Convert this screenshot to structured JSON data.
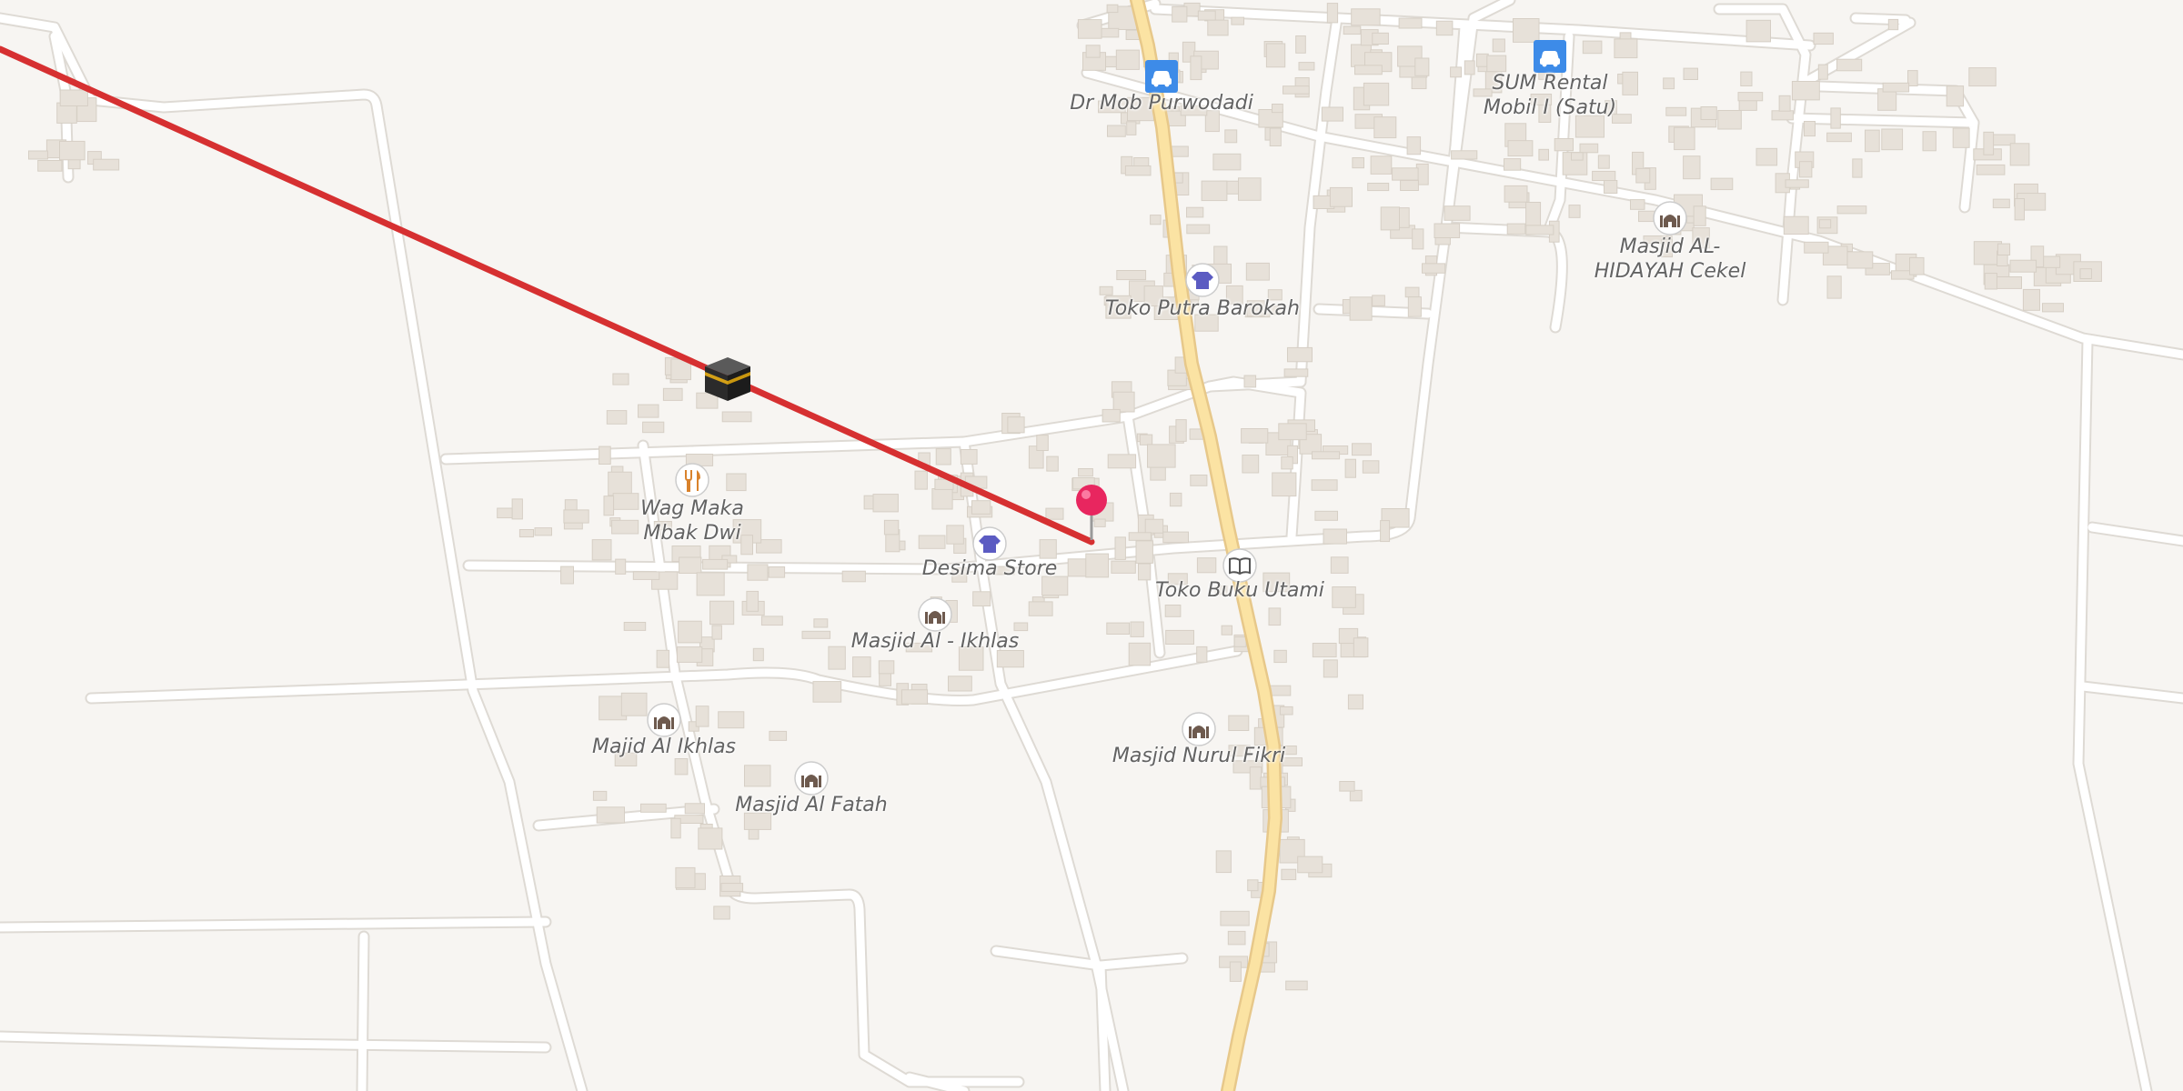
{
  "map": {
    "qibla_line_color": "#d63031",
    "pin_color": "#e8265f",
    "main_road_color": "#fbe3a3",
    "minor_road_color": "#ffffff",
    "background_color": "#f7f5f2",
    "pin_icon": "location-pin-icon",
    "qibla_icon": "kaaba-icon"
  },
  "pois": [
    {
      "id": "dr-mob-purwodadi",
      "label": "Dr Mob Purwodadi",
      "icon": "car-icon"
    },
    {
      "id": "sum-rental",
      "label": "SUM Rental\nMobil I (Satu)",
      "icon": "car-icon"
    },
    {
      "id": "masjid-al-hidayah",
      "label": "Masjid AL-\nHIDAYAH Cekel",
      "icon": "mosque-icon"
    },
    {
      "id": "toko-putra-barokah",
      "label": "Toko Putra Barokah",
      "icon": "clothes-icon"
    },
    {
      "id": "wag-maka",
      "label": "Wag Maka\nMbak Dwi",
      "icon": "restaurant-icon"
    },
    {
      "id": "desima-store",
      "label": "Desima Store",
      "icon": "clothes-icon"
    },
    {
      "id": "toko-buku-utami",
      "label": "Toko Buku Utami",
      "icon": "book-icon"
    },
    {
      "id": "masjid-al-ikhlas",
      "label": "Masjid Al - Ikhlas",
      "icon": "mosque-icon"
    },
    {
      "id": "majid-al-ikhlas",
      "label": "Majid Al Ikhlas",
      "icon": "mosque-icon"
    },
    {
      "id": "masjid-nurul-fikri",
      "label": "Masjid Nurul Fikri",
      "icon": "mosque-icon"
    },
    {
      "id": "masjid-al-fatah",
      "label": "Masjid Al Fatah",
      "icon": "mosque-icon"
    }
  ]
}
